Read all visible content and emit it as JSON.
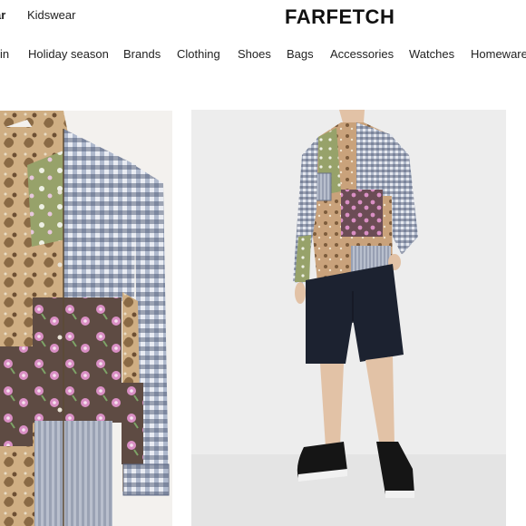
{
  "header": {
    "gender_partial": "ar",
    "gender_kids": "Kidswear",
    "logo": "FARFETCH"
  },
  "nav": {
    "items": [
      {
        "label": "in"
      },
      {
        "label": "Holiday season"
      },
      {
        "label": "Brands"
      },
      {
        "label": "Clothing"
      },
      {
        "label": "Shoes"
      },
      {
        "label": "Bags"
      },
      {
        "label": "Accessories"
      },
      {
        "label": "Watches"
      },
      {
        "label": "Homeware"
      }
    ]
  },
  "product": {
    "images": [
      {
        "subject": "patchwork shirt close-up"
      },
      {
        "subject": "model wearing patchwork shirt and navy shorts"
      }
    ]
  },
  "colors": {
    "paisley": "#c9a477",
    "gingham": "#6f7f9c",
    "floral_dark": "#5b4a45",
    "pink_patch": "#8a5a6e",
    "shorts": "#1c2230",
    "background": "#ededed"
  }
}
